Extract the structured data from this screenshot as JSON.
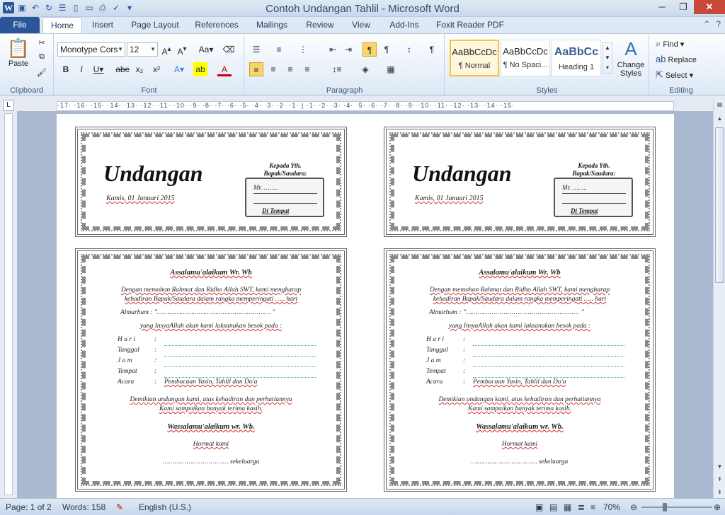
{
  "window": {
    "title": "Contoh Undangan Tahlil  -  Microsoft Word"
  },
  "tabs": [
    "File",
    "Home",
    "Insert",
    "Page Layout",
    "References",
    "Mailings",
    "Review",
    "View",
    "Add-Ins",
    "Foxit Reader PDF"
  ],
  "ribbon": {
    "clipboard": {
      "paste": "Paste",
      "label": "Clipboard"
    },
    "font": {
      "name": "Monotype Cors",
      "size": "12",
      "label": "Font"
    },
    "paragraph": {
      "label": "Paragraph"
    },
    "styles": {
      "label": "Styles",
      "items": [
        {
          "preview": "AaBbCcDc",
          "name": "¶ Normal"
        },
        {
          "preview": "AaBbCcDc",
          "name": "¶ No Spaci..."
        },
        {
          "preview": "AaBbCc",
          "name": "Heading 1"
        }
      ],
      "change": "Change Styles"
    },
    "editing": {
      "label": "Editing",
      "find": "Find",
      "replace": "Replace",
      "select": "Select"
    }
  },
  "ruler": {
    "text": "·17· ·16· ·15· ·14· ·13· ·12· ·11· ·10· ·9· ·8· ·7· ·6· ·5· ·4· ·3· ·2· ·1· |  ·1· ·2· ·3· ·4· ·5· ·6· ·7· ·8· ·9· ·10· ·11· ·12· ·13· ·14· ·15·"
  },
  "card": {
    "title": "Undangan",
    "date": "Kamis, 01 Januari 2015",
    "kepada": "Kepada Yth.",
    "bapak": "Bapak/Saudara:",
    "mr": "Mr.  ……..",
    "ditempat": "Di Tempat",
    "salam": "Assalamu'alaikum Wr. Wb",
    "p1a": "Dengan memohon  Rahmat dan Ridho Allah SWT, kami mengharap",
    "p1b": "kehadiran Bapak/Saudara dalam rangka memperingati  ….. hari",
    "almarhum": "Almarhum : \"………………………………………………… \"",
    "insya": "yang InsyaAllah akan kami laksanakan besok pada :",
    "rows": [
      {
        "k": "H a r i",
        "v": ""
      },
      {
        "k": "Tanggal",
        "v": ""
      },
      {
        "k": "J a m",
        "v": ""
      },
      {
        "k": "Tempat",
        "v": ""
      },
      {
        "k": "Acara",
        "v": "Pembacaan Yasin, Tahlil dan Do'a"
      }
    ],
    "p2a": "Demikian undangan kami, atas kehadiran dan perhatiannya",
    "p2b": "Kami sampaikan banyak terima kasih.",
    "wassalam": "Wassalamu'alaikum wr. Wb.",
    "hormat": "Hormat kami",
    "keluarga": "……………………………  sekeluarga"
  },
  "status": {
    "page": "Page: 1 of 2",
    "words": "Words: 158",
    "language": "English (U.S.)",
    "zoom": "70%",
    "zoom_level": 70
  }
}
